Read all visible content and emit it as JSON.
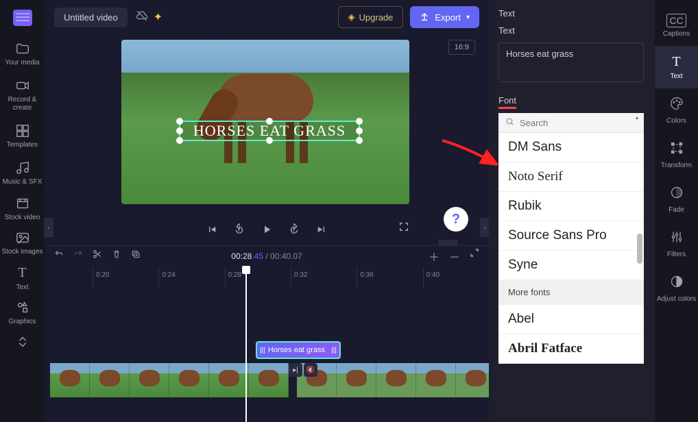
{
  "header": {
    "title": "Untitled video",
    "upgrade_label": "Upgrade",
    "export_label": "Export"
  },
  "left_nav": [
    {
      "label": "Your media"
    },
    {
      "label": "Record & create"
    },
    {
      "label": "Templates"
    },
    {
      "label": "Music & SFX"
    },
    {
      "label": "Stock video"
    },
    {
      "label": "Stock images"
    },
    {
      "label": "Text"
    },
    {
      "label": "Graphics"
    }
  ],
  "preview": {
    "overlay_text": "Horses eat grass",
    "aspect": "16:9"
  },
  "timeline": {
    "current": "00:28",
    "current_frame": ".45",
    "total": "00:40",
    "total_frame": ".07",
    "ticks": [
      "0:20",
      "0:24",
      "0:28",
      "0:32",
      "0:36",
      "0:40"
    ],
    "text_clip_label": "Horses eat grass"
  },
  "right_panel": {
    "heading": "Text",
    "text_label": "Text",
    "text_value": "Horses eat grass",
    "font_label": "Font",
    "search_placeholder": "Search",
    "fonts": [
      "DM Sans",
      "Noto Serif",
      "Rubik",
      "Source Sans Pro",
      "Syne"
    ],
    "more_label": "More fonts",
    "extra_fonts": [
      "Abel",
      "Abril Fatface"
    ]
  },
  "right_nav": [
    {
      "label": "Captions"
    },
    {
      "label": "Text"
    },
    {
      "label": "Colors"
    },
    {
      "label": "Transform"
    },
    {
      "label": "Fade"
    },
    {
      "label": "Filters"
    },
    {
      "label": "Adjust colors"
    }
  ]
}
